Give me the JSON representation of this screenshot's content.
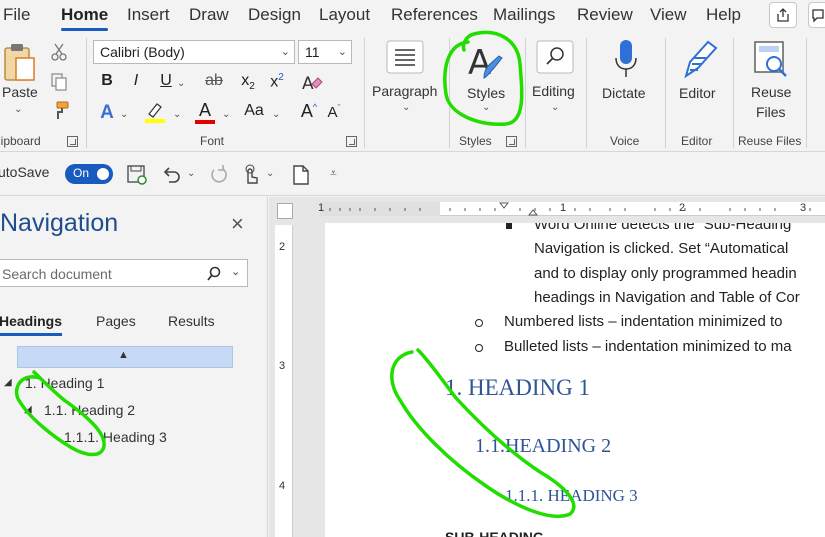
{
  "tabs": [
    "File",
    "Home",
    "Insert",
    "Draw",
    "Design",
    "Layout",
    "References",
    "Mailings",
    "Review",
    "View",
    "Help"
  ],
  "active_tab": "Home",
  "ribbon": {
    "clipboard": {
      "paste_label": "Paste",
      "group_label": "lipboard"
    },
    "font": {
      "font_name": "Calibri (Body)",
      "font_size": "11",
      "group_label": "Font",
      "bold": "B",
      "italic": "I",
      "underline": "U",
      "strike": "ab",
      "subscript": "x",
      "subscript_mark": "2",
      "superscript": "x",
      "superscript_mark": "2",
      "text_effects": "A",
      "font_color": "A",
      "change_case": "Aa",
      "grow": "A",
      "shrink": "A",
      "highlight_color": "#ffff00",
      "font_color_bar": "#e00000"
    },
    "paragraph": {
      "label": "Paragraph"
    },
    "styles": {
      "label": "Styles",
      "group_label": "Styles"
    },
    "editing": {
      "label": "Editing"
    },
    "voice": {
      "dictate_label": "Dictate",
      "group_label": "Voice"
    },
    "editor": {
      "label": "Editor",
      "group_label": "Editor"
    },
    "reuse": {
      "label_line1": "Reuse",
      "label_line2": "Files",
      "group_label": "Reuse Files"
    }
  },
  "qat": {
    "autosave_label": "utoSave",
    "toggle_label": "On"
  },
  "nav": {
    "title": "Navigation",
    "close": "×",
    "search_placeholder": "Search document",
    "tabs": [
      "Headings",
      "Pages",
      "Results"
    ],
    "active_tab": "Headings",
    "tree": [
      "1. Heading 1",
      "1.1. Heading 2",
      "1.1.1. Heading 3"
    ]
  },
  "ruler": {
    "h_numbers": [
      "1",
      "1",
      "2",
      "3"
    ],
    "v_numbers": [
      "2",
      "3",
      "4"
    ]
  },
  "document": {
    "lines": [
      "Word Online detects the “Sub-Heading",
      "Navigation is clicked.  Set “Automatical",
      "and to display only programmed headin",
      "headings in Navigation and Table of Cor"
    ],
    "sub_bullets": [
      "Numbered lists – indentation minimized to",
      "Bulleted lists – indentation minimized to ma"
    ],
    "heading1": "1.  HEADING 1",
    "heading2": "1.1.HEADING 2",
    "heading3": "1.1.1.   HEADING 3",
    "cutoff": "SUB-HEADING"
  },
  "colors": {
    "accent": "#185abd",
    "heading": "#2f5496",
    "annotation": "#22dd00"
  }
}
